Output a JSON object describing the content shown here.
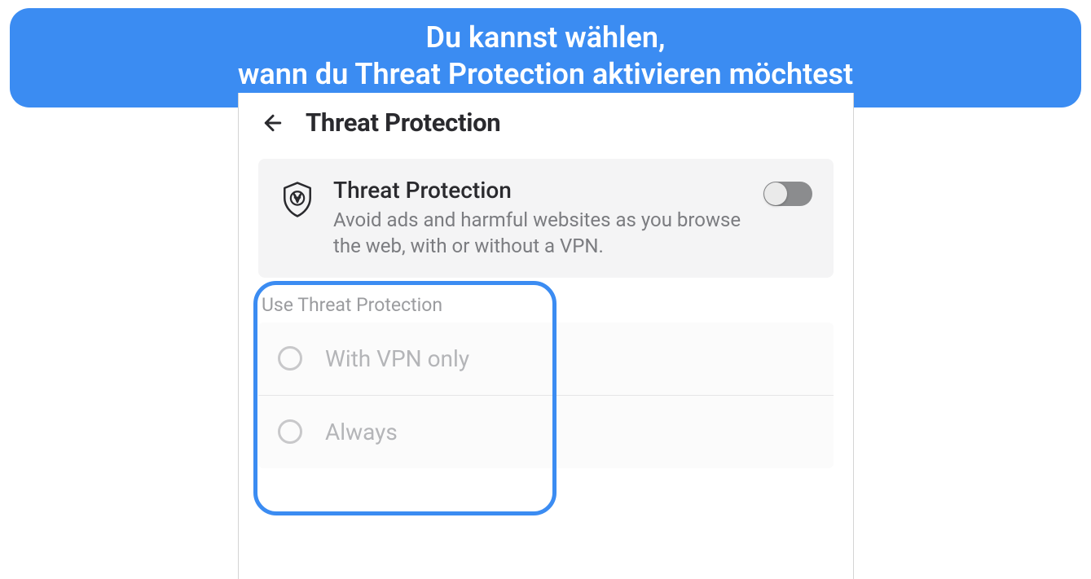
{
  "banner": {
    "line1": "Du kannst wählen,",
    "line2": "wann du Threat Protection aktivieren möchtest"
  },
  "header": {
    "title": "Threat Protection"
  },
  "feature": {
    "title": "Threat Protection",
    "description": "Avoid ads and harmful websites as you browse the web, with or without a VPN.",
    "enabled": false
  },
  "options": {
    "section_label": "Use Threat Protection",
    "items": [
      {
        "label": "With VPN only",
        "selected": false
      },
      {
        "label": "Always",
        "selected": false
      }
    ]
  },
  "colors": {
    "banner_bg": "#3b8cf2",
    "highlight": "#3b8cf2",
    "text_primary": "#2a2a2e",
    "text_muted": "#7b7c80"
  }
}
